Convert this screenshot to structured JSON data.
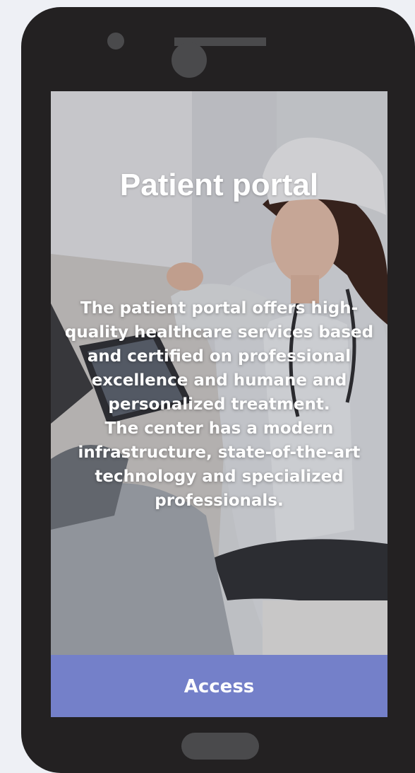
{
  "hero": {
    "title": "Patient portal",
    "paragraph_1": "The patient portal offers high-quality healthcare services based and certified on professional excellence and humane and personalized treatment.",
    "paragraph_2": "The center has a modern infrastructure, state-of-the-art technology and specialized professionals."
  },
  "actions": {
    "access_label": "Access"
  },
  "colors": {
    "device_body": "#232122",
    "device_details": "#4a4a4c",
    "access_button": "#7480c9",
    "page_background": "#eef0f5"
  }
}
